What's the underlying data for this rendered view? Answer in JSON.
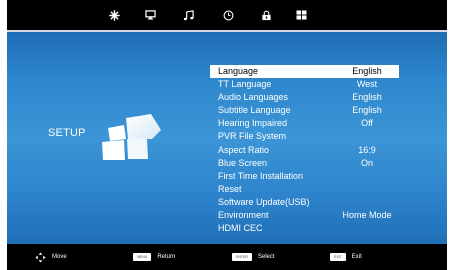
{
  "top_tabs": [
    {
      "icon": "picture-settings-icon"
    },
    {
      "icon": "screen-icon"
    },
    {
      "icon": "music-note-icon"
    },
    {
      "icon": "clock-icon"
    },
    {
      "icon": "lock-icon"
    },
    {
      "icon": "setup-grid-icon"
    }
  ],
  "page_title": "SETUP",
  "menu": {
    "items": [
      {
        "label": "Language",
        "value": "English",
        "selected": true
      },
      {
        "label": "TT Language",
        "value": "West"
      },
      {
        "label": "Audio Languages",
        "value": "English"
      },
      {
        "label": "Subtitle Language",
        "value": "English"
      },
      {
        "label": "Hearing Impaired",
        "value": "Off"
      },
      {
        "label": "PVR File System",
        "value": ""
      },
      {
        "label": "Aspect Ratio",
        "value": "16:9"
      },
      {
        "label": "Blue Screen",
        "value": "On"
      },
      {
        "label": "First Time Installation",
        "value": ""
      },
      {
        "label": "Reset",
        "value": ""
      },
      {
        "label": "Software Update(USB)",
        "value": ""
      },
      {
        "label": "Environment",
        "value": "Home Mode"
      },
      {
        "label": "HDMI CEC",
        "value": ""
      }
    ]
  },
  "footer": {
    "move": {
      "label": "Move",
      "icon": "navigation-arrows-icon"
    },
    "menu": {
      "key": "MENU",
      "label": "Return"
    },
    "enter": {
      "key": "ENTER",
      "label": "Select"
    },
    "exit": {
      "key": "EXIT",
      "label": "Exit"
    }
  },
  "colors": {
    "panel": "#2e86cc",
    "highlight": "#ffffff",
    "bar": "#000000"
  }
}
